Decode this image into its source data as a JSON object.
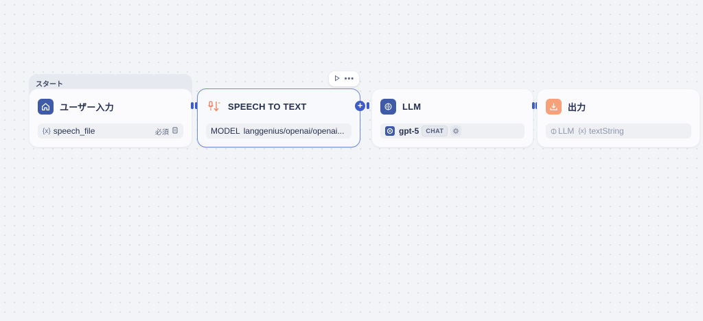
{
  "start_tag": "スタート",
  "nodes": {
    "user_input": {
      "title": "ユーザー入力",
      "variable": "speech_file",
      "variable_glyph": "{x}",
      "required_label": "必須",
      "icon": "home-icon",
      "icon_bg": "#3f5aa6"
    },
    "speech_to_text": {
      "title": "SPEECH TO TEXT",
      "model_label": "MODEL",
      "model_value": "langgenius/openai/openai...",
      "icon": "speech-to-text-icon",
      "icon_color": "#f0896a"
    },
    "llm": {
      "title": "LLM",
      "model": "gpt-5",
      "mode_badge": "CHAT",
      "icon": "llm-brain-icon",
      "icon_bg": "#3f5aa6"
    },
    "output": {
      "title": "出力",
      "source_label": "LLM",
      "variable_glyph": "{x}",
      "variable": "textString",
      "icon": "output-icon",
      "icon_bg": "#f7a07a"
    }
  },
  "toolbar": {
    "run_icon": "play-icon",
    "more_icon": "more-icon"
  },
  "colors": {
    "accent": "#3d5cc6",
    "canvas_bg": "#f2f4f7"
  }
}
